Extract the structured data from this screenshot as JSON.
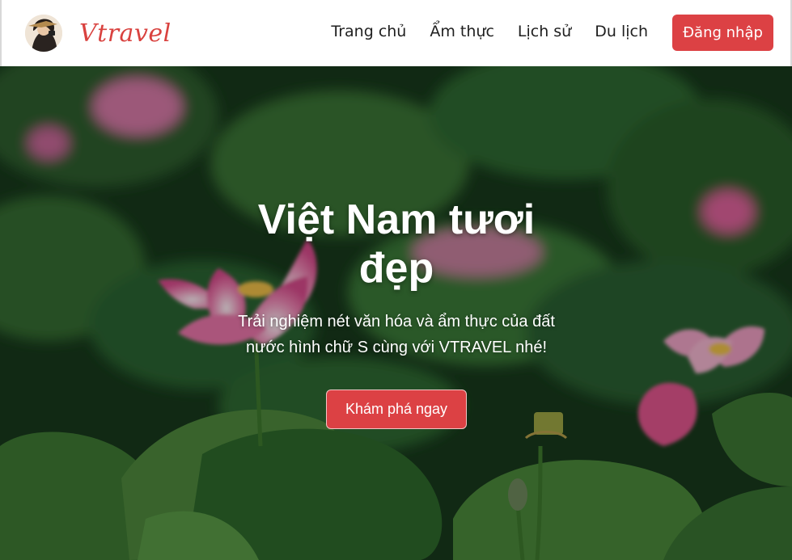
{
  "brand": {
    "name": "Vtravel",
    "logo_icon": "traveler-portrait-icon"
  },
  "nav": {
    "links": [
      "Trang chủ",
      "Ẩm thực",
      "Lịch sử",
      "Du lịch"
    ],
    "login_label": "Đăng nhập"
  },
  "hero": {
    "title": "Việt Nam tươi đẹp",
    "subtitle": "Trải nghiệm nét văn hóa và ẩm thực của đất nước hình chữ S cùng với VTRAVEL nhé!",
    "cta_label": "Khám phá ngay",
    "background_icon": "lotus-pond-image"
  },
  "colors": {
    "accent": "#dc4144",
    "brand_text": "#d9423f",
    "foliage": "#2f6b2e",
    "lotus": "#e86aa0"
  }
}
